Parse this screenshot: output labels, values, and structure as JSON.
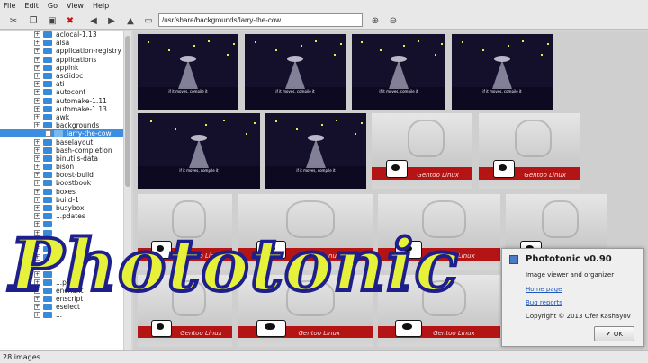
{
  "menu": [
    "File",
    "Edit",
    "Go",
    "View",
    "Help"
  ],
  "toolbar": {
    "icons": [
      "cut-icon",
      "copy-icon",
      "paste-icon",
      "delete-icon",
      "back-icon",
      "forward-icon",
      "up-icon",
      "zoom-in-icon",
      "zoom-out-icon"
    ],
    "path": "/usr/share/backgrounds/larry-the-cow"
  },
  "tree": {
    "items": [
      "aclocal-1.13",
      "alsa",
      "application-registry",
      "applications",
      "applnk",
      "asciidoc",
      "ati",
      "autoconf",
      "automake-1.11",
      "automake-1.13",
      "awk",
      "backgrounds",
      "larry-the-cow",
      "baselayout",
      "bash-completion",
      "binutils-data",
      "bison",
      "boost-build",
      "boostbook",
      "boxes",
      "build-1",
      "busybox",
      "...pdates",
      "",
      "",
      "",
      "",
      "",
      "",
      "",
      "...pcf",
      "enchant",
      "enscript",
      "eselect",
      "..."
    ],
    "selected_index": 12
  },
  "thumbnails": {
    "night_caption": "if it moves, compile it",
    "cow_caption": "Gentoo Linux"
  },
  "about": {
    "title": "Phototonic v0.90",
    "description": "Image viewer and organizer",
    "home_link": "Home page",
    "bugs_link": "Bug reports",
    "copyright": "Copyright © 2013 Ofer Kashayov",
    "ok_label": "OK"
  },
  "status": "28 images",
  "overlay_title": "Phototonic"
}
